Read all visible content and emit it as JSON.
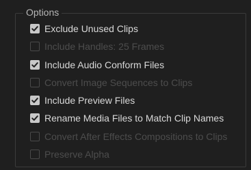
{
  "section": {
    "title": "Options"
  },
  "options": [
    {
      "label": "Exclude Unused Clips",
      "checked": true,
      "enabled": true
    },
    {
      "label": "Include Handles:  25 Frames",
      "checked": false,
      "enabled": false
    },
    {
      "label": "Include Audio Conform Files",
      "checked": true,
      "enabled": true
    },
    {
      "label": "Convert Image Sequences to Clips",
      "checked": false,
      "enabled": false
    },
    {
      "label": "Include Preview Files",
      "checked": true,
      "enabled": true
    },
    {
      "label": "Rename Media Files to Match Clip Names",
      "checked": true,
      "enabled": true
    },
    {
      "label": "Convert After Effects Compositions to Clips",
      "checked": false,
      "enabled": false
    },
    {
      "label": "Preserve Alpha",
      "checked": false,
      "enabled": false
    }
  ],
  "colors": {
    "background": "#1f1f1f",
    "checkbox_checked": "#c8c8c8",
    "label_enabled": "#d9d9d9",
    "label_disabled": "#4d4d4d"
  }
}
